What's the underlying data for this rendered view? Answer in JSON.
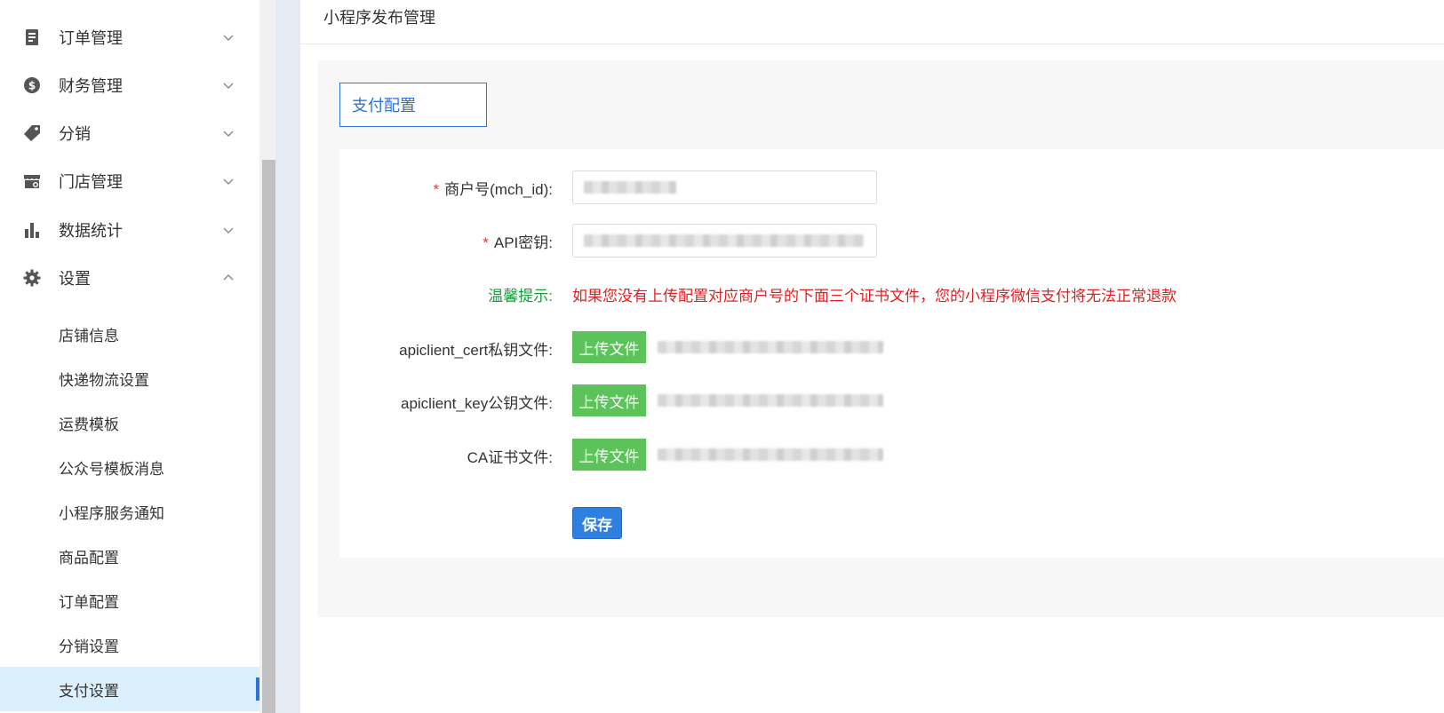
{
  "sidebar": {
    "menus": [
      {
        "label": "订单管理",
        "icon": "document-icon",
        "expanded": false
      },
      {
        "label": "财务管理",
        "icon": "money-icon",
        "expanded": false
      },
      {
        "label": "分销",
        "icon": "tag-icon",
        "expanded": false
      },
      {
        "label": "门店管理",
        "icon": "store-icon",
        "expanded": false
      },
      {
        "label": "数据统计",
        "icon": "bar-chart-icon",
        "expanded": false
      },
      {
        "label": "设置",
        "icon": "gear-icon",
        "expanded": true
      }
    ],
    "settings_items": [
      {
        "label": "店铺信息"
      },
      {
        "label": "快递物流设置"
      },
      {
        "label": "运费模板"
      },
      {
        "label": "公众号模板消息"
      },
      {
        "label": "小程序服务通知"
      },
      {
        "label": "商品配置"
      },
      {
        "label": "订单配置"
      },
      {
        "label": "分销设置"
      },
      {
        "label": "支付设置",
        "active": true
      }
    ]
  },
  "main": {
    "page_title": "小程序发布管理",
    "tab_label": "支付配置",
    "form": {
      "mch_id_label": "商户号(mch_id):",
      "api_key_label": "API密钥:",
      "required_mark": "*",
      "tip_label": "温馨提示:",
      "tip_text": "如果您没有上传配置对应商户号的下面三个证书文件，您的小程序微信支付将无法正常退款",
      "cert_label": "apiclient_cert私钥文件:",
      "key_label": "apiclient_key公钥文件:",
      "ca_label": "CA证书文件:",
      "upload_label": "上传文件",
      "save_label": "保存"
    }
  },
  "colors": {
    "primary": "#2d73d8",
    "upload_green": "#5cc35a",
    "tip_green": "#1a9c3a",
    "tip_red": "#e02020",
    "active_bg": "#dbf0fd"
  }
}
